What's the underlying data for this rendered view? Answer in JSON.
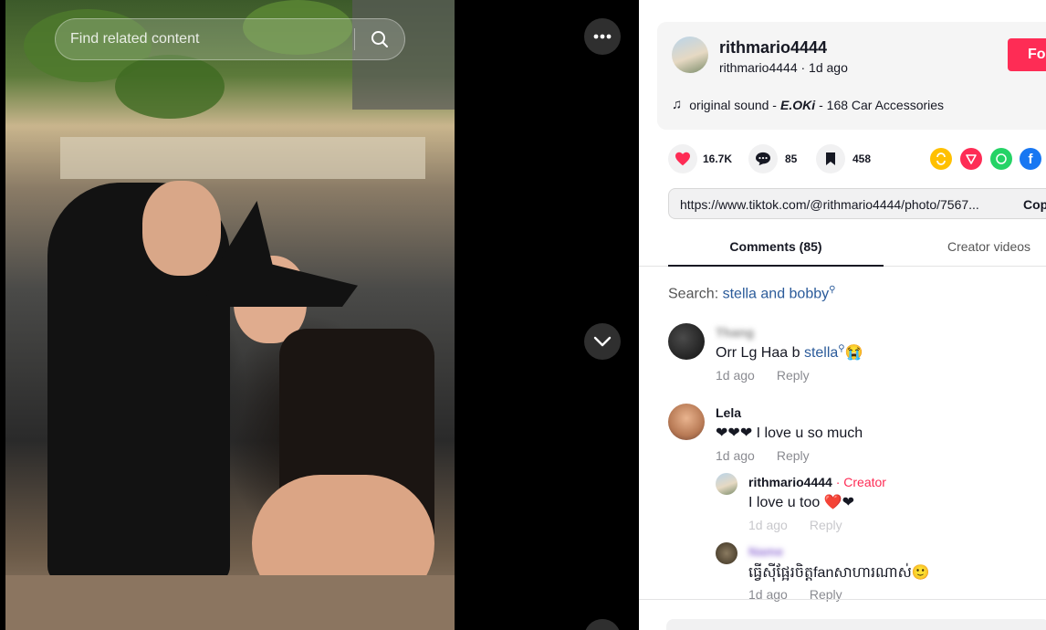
{
  "search": {
    "placeholder": "Find related content"
  },
  "author": {
    "username": "rithmario4444",
    "subline": "rithmario4444 · 1d ago",
    "follow_label": "Fo"
  },
  "sound": {
    "prefix": "original sound -",
    "artist": "E.OKi",
    "suffix": "- 168 Car Accessories"
  },
  "actions": {
    "likes": "16.7K",
    "comments": "85",
    "saves": "458"
  },
  "share_link": {
    "url": "https://www.tiktok.com/@rithmario4444/photo/7567...",
    "copy_label": "Cop"
  },
  "tabs": {
    "comments": "Comments (85)",
    "creator_videos": "Creator videos"
  },
  "search_suggest": {
    "label": "Search:",
    "query": "stella and bobby"
  },
  "comments": [
    {
      "name": "Thang",
      "text_a": "Orr Lg Haa b",
      "text_link": "stella",
      "emoji": "😭",
      "time": "1d ago",
      "reply": "Reply"
    },
    {
      "name": "Lela",
      "text": "❤❤❤ I love u so much",
      "time": "1d ago",
      "reply": "Reply"
    }
  ],
  "replies": [
    {
      "name": "rithmario4444",
      "tag": "· Creator",
      "text": "I love u too ❤️❤",
      "time": "1d ago",
      "reply": "Reply"
    },
    {
      "name": "Name",
      "text": "ធ្វើស៊ីផ្អែរចិត្តfanសាហារណាស់🙂",
      "time": "1d ago",
      "reply": "Reply"
    }
  ],
  "colors": {
    "accent": "#fe2c55",
    "link": "#2b5b9a"
  }
}
